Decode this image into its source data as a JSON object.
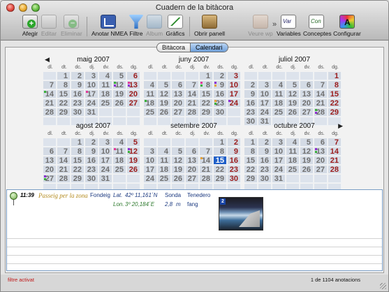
{
  "window": {
    "title": "Cuadern de la bitàcora"
  },
  "toolbar": {
    "items": [
      {
        "key": "afegir",
        "label": "Afegir",
        "icon": "add-entry-icon",
        "enabled": true
      },
      {
        "key": "editar",
        "label": "Editar",
        "icon": "edit-entry-icon",
        "enabled": false
      },
      {
        "key": "eliminar",
        "label": "Eliminar",
        "icon": "delete-entry-icon",
        "enabled": false
      },
      {
        "key": "nmea",
        "label": "Anotar NMEA",
        "icon": "nmea-chart-icon",
        "enabled": true
      },
      {
        "key": "filtre",
        "label": "Filtre",
        "icon": "funnel-filter-icon",
        "enabled": true
      },
      {
        "key": "album",
        "label": "Album",
        "icon": "photo-album-icon",
        "enabled": false
      },
      {
        "key": "grafics",
        "label": "Gràfics",
        "icon": "graph-icon",
        "enabled": true
      },
      {
        "key": "obrir",
        "label": "Obrir panell",
        "icon": "open-panel-icon",
        "enabled": true
      },
      {
        "key": "veure",
        "label": "Veure wp",
        "icon": "waypoint-icon",
        "enabled": false
      },
      {
        "key": "variables",
        "label": "Variables",
        "icon": "variables-icon",
        "enabled": true
      },
      {
        "key": "conceptes",
        "label": "Conceptes",
        "icon": "concepts-icon",
        "enabled": true
      },
      {
        "key": "configurar",
        "label": "Configurar",
        "icon": "color-wheel-icon",
        "enabled": true
      }
    ],
    "overflow_icon": "chevron-double-right-icon"
  },
  "view_switch": {
    "tabs": [
      "Bitàcora",
      "Calendari"
    ],
    "selected": "Calendari"
  },
  "calendar": {
    "weekdays": [
      "dl.",
      "dt.",
      "dc.",
      "dj.",
      "dv.",
      "ds.",
      "dg."
    ],
    "prev_icon": "◀",
    "next_icon": "▶",
    "months": [
      {
        "name": "maig 2007",
        "offset": 1,
        "days": 31
      },
      {
        "name": "juny 2007",
        "offset": 4,
        "days": 30
      },
      {
        "name": "juliol 2007",
        "offset": 6,
        "days": 31
      },
      {
        "name": "agost 2007",
        "offset": 2,
        "days": 31
      },
      {
        "name": "setembre 2007",
        "offset": 5,
        "days": 30
      },
      {
        "name": "octubre 2007",
        "offset": 0,
        "days": 31
      }
    ],
    "marked_days": [
      {
        "month": 0,
        "day": 12,
        "colors": [
          "#3bb13b",
          "#8e2fd1"
        ]
      },
      {
        "month": 0,
        "day": 13,
        "colors": [
          "#e5399a",
          "#8e2fd1"
        ]
      },
      {
        "month": 0,
        "day": 14,
        "colors": [
          "#3bb13b"
        ]
      },
      {
        "month": 0,
        "day": 17,
        "colors": [
          "#e5399a"
        ]
      },
      {
        "month": 1,
        "day": 8,
        "colors": [
          "#e5399a",
          "#3bb13b"
        ]
      },
      {
        "month": 1,
        "day": 9,
        "colors": [
          "#8e2fd1",
          "#e5a33b"
        ]
      },
      {
        "month": 1,
        "day": 18,
        "colors": [
          "#3bb13b"
        ]
      },
      {
        "month": 1,
        "day": 23,
        "colors": [
          "#e5a33b",
          "#3bb13b"
        ]
      },
      {
        "month": 1,
        "day": 24,
        "colors": [
          "#8e2fd1"
        ]
      },
      {
        "month": 2,
        "day": 28,
        "colors": [
          "#3bb13b",
          "#8e2fd1"
        ]
      },
      {
        "month": 3,
        "day": 11,
        "colors": [
          "#e5399a"
        ]
      },
      {
        "month": 3,
        "day": 12,
        "colors": [
          "#8e2fd1",
          "#3bb13b"
        ]
      },
      {
        "month": 3,
        "day": 27,
        "colors": [
          "#8e2fd1",
          "#3bb13b"
        ]
      },
      {
        "month": 4,
        "day": 14,
        "colors": [
          "#e5a33b"
        ]
      },
      {
        "month": 5,
        "day": 13,
        "colors": [
          "#8e2fd1",
          "#3bb13b"
        ]
      }
    ],
    "today": {
      "month": 4,
      "day": 15
    }
  },
  "entry": {
    "time": "11:39",
    "title": "Passeig per la zona",
    "anchoring": "Fondeig",
    "lat_label": "Lat.",
    "lat": "42º 11,161´N",
    "lon_label": "Lon.",
    "lon": "3º 20,184´E",
    "depth_label": "Sonda",
    "depth": "2,8",
    "depth_unit": "m",
    "holding_label": "Tenedero",
    "holding": "fang",
    "photo_count": "2"
  },
  "status": {
    "filter": "filtre activat",
    "count": "1 de 1104 anotacions"
  }
}
